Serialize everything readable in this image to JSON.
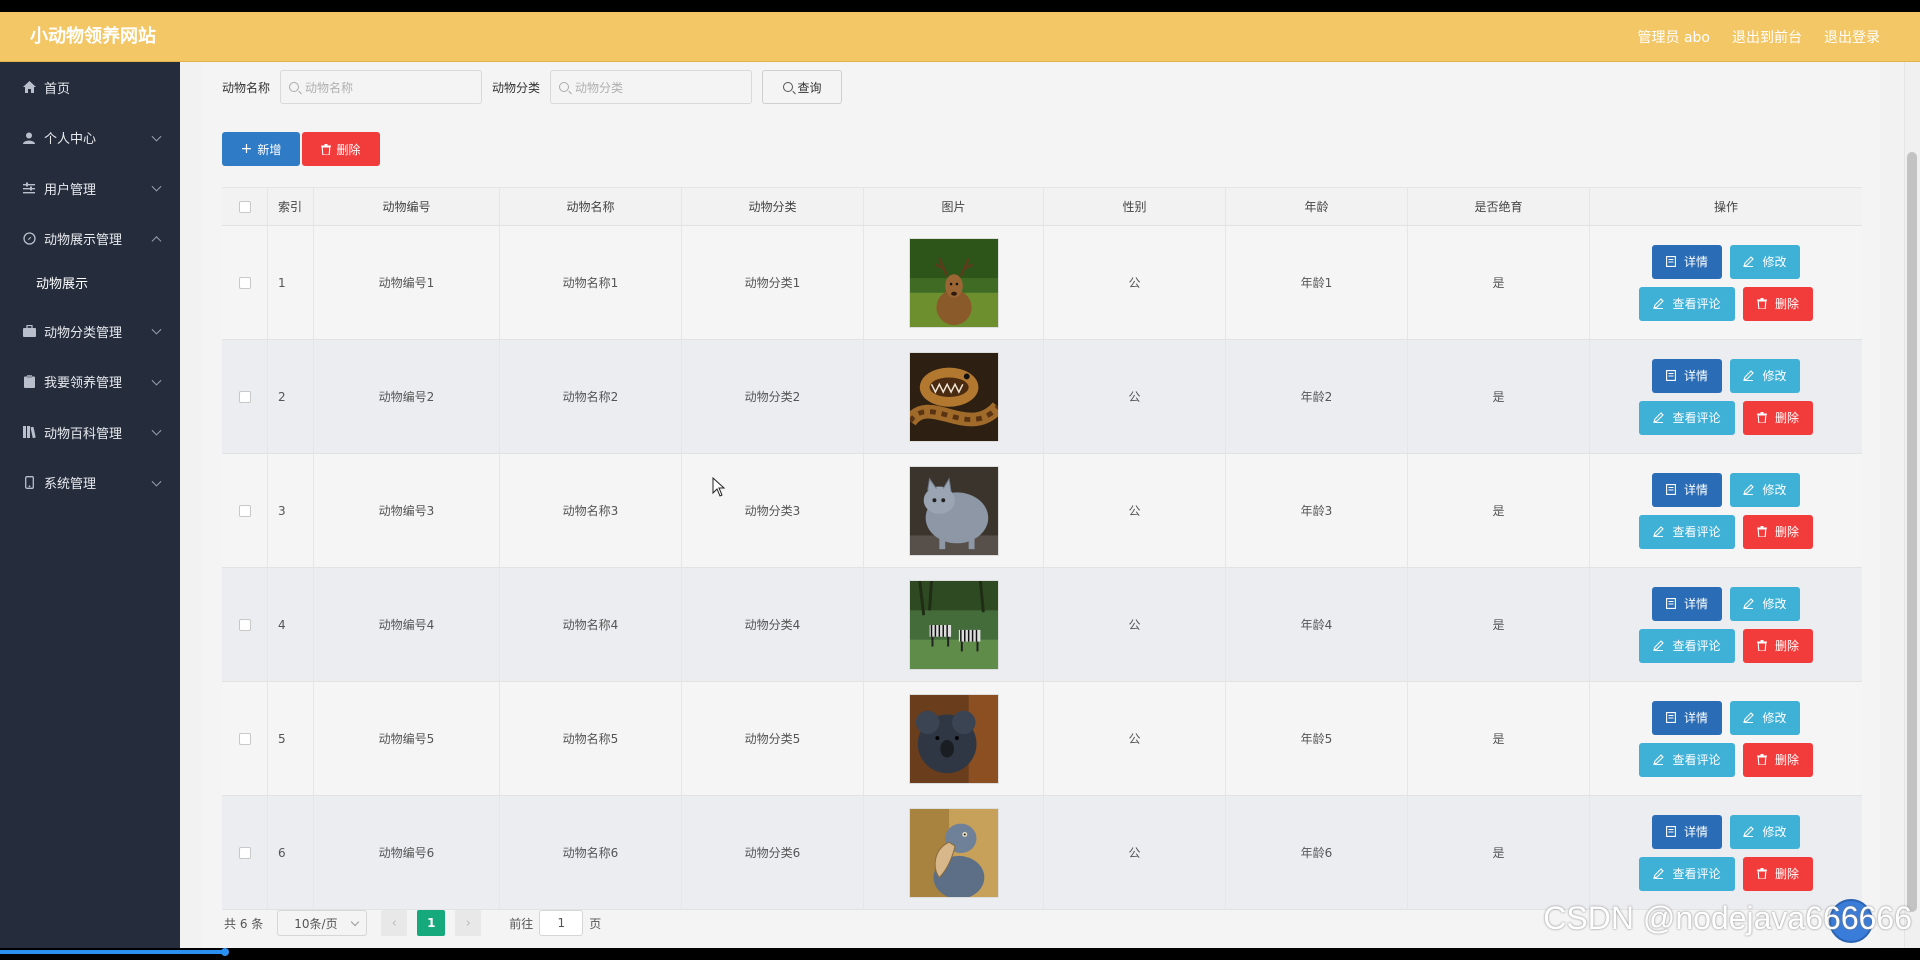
{
  "header": {
    "site_title": "小动物领养网站",
    "user_label": "管理员 abo",
    "to_frontend": "退出到前台",
    "logout": "退出登录"
  },
  "sidebar": {
    "items": [
      {
        "label": "首页",
        "icon": "home-icon"
      },
      {
        "label": "个人中心",
        "icon": "user-icon"
      },
      {
        "label": "用户管理",
        "icon": "sliders-icon"
      },
      {
        "label": "动物展示管理",
        "icon": "compass-icon",
        "expanded": true,
        "children": [
          "动物展示"
        ]
      },
      {
        "label": "动物分类管理",
        "icon": "briefcase-icon"
      },
      {
        "label": "我要领养管理",
        "icon": "clipboard-icon"
      },
      {
        "label": "动物百科管理",
        "icon": "book-icon"
      },
      {
        "label": "系统管理",
        "icon": "phone-icon"
      }
    ]
  },
  "search": {
    "name_label": "动物名称",
    "name_placeholder": "动物名称",
    "category_label": "动物分类",
    "category_placeholder": "动物分类",
    "query_label": "查询"
  },
  "actions": {
    "add_label": "新增",
    "delete_label": "删除"
  },
  "table": {
    "columns": [
      "索引",
      "动物编号",
      "动物名称",
      "动物分类",
      "图片",
      "性别",
      "年龄",
      "是否绝育",
      "操作"
    ],
    "rows": [
      {
        "index": "1",
        "no": "动物编号1",
        "name": "动物名称1",
        "category": "动物分类1",
        "image": "deer",
        "sex": "公",
        "age": "年龄1",
        "sterilized": "是"
      },
      {
        "index": "2",
        "no": "动物编号2",
        "name": "动物名称2",
        "category": "动物分类2",
        "image": "snake",
        "sex": "公",
        "age": "年龄2",
        "sterilized": "是"
      },
      {
        "index": "3",
        "no": "动物编号3",
        "name": "动物名称3",
        "category": "动物分类3",
        "image": "cat",
        "sex": "公",
        "age": "年龄3",
        "sterilized": "是"
      },
      {
        "index": "4",
        "no": "动物编号4",
        "name": "动物名称4",
        "category": "动物分类4",
        "image": "zebras",
        "sex": "公",
        "age": "年龄4",
        "sterilized": "是"
      },
      {
        "index": "5",
        "no": "动物编号5",
        "name": "动物名称5",
        "category": "动物分类5",
        "image": "koala",
        "sex": "公",
        "age": "年龄5",
        "sterilized": "是"
      },
      {
        "index": "6",
        "no": "动物编号6",
        "name": "动物名称6",
        "category": "动物分类6",
        "image": "shoebill",
        "sex": "公",
        "age": "年龄6",
        "sterilized": "是"
      }
    ],
    "row_actions": {
      "detail": "详情",
      "edit": "修改",
      "review": "查看评论",
      "delete": "删除"
    }
  },
  "pager": {
    "total": "共 6 条",
    "page_size": "10条/页",
    "current_page": "1",
    "goto_label": "前往",
    "goto_value": "1",
    "page_suffix": "页"
  },
  "watermark": "CSDN @nodejava666666",
  "colors": {
    "header": "#f3c766",
    "sidebar": "#252d3d",
    "primary": "#2f7bc6",
    "info": "#3fb0d6",
    "danger": "#f23b3b",
    "pager_active": "#16a97b"
  }
}
